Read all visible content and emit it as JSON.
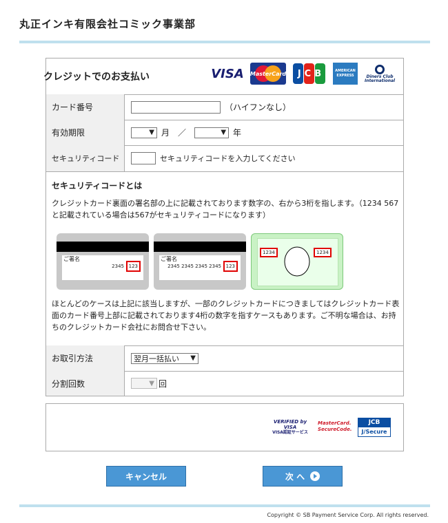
{
  "header": {
    "title": "丸正インキ有限会社コミック事業部"
  },
  "panel": {
    "title": "クレジットでのお支払い"
  },
  "brands": {
    "visa": "VISA",
    "mastercard": "MasterCard",
    "jcb": "JCB",
    "amex": "AMERICAN EXPRESS",
    "diners": "Diners Club International"
  },
  "form": {
    "card_number": {
      "label": "カード番号",
      "value": "",
      "note": "（ハイフンなし）"
    },
    "expiry": {
      "label": "有効期限",
      "month_suffix": "月",
      "separator": "／",
      "year_suffix": "年"
    },
    "security_code": {
      "label": "セキュリティコード",
      "value": "",
      "note": "セキュリティコードを入力してください"
    },
    "payment_method": {
      "label": "お取引方法",
      "selected": "翌月一括払い"
    },
    "installments": {
      "label": "分割回数",
      "suffix": "回"
    }
  },
  "info": {
    "title": "セキュリティコードとは",
    "p1": "クレジットカード裏面の署名部の上に記載されております数字の、右から3桁を指します。（1234 567と記載されている場合は567がセキュリティコードになります）",
    "p2": "ほとんどのケースは上記に該当しますが、一部のクレジットカードにつきましてはクレジットカード表面のカード番号上部に記載されております4桁の数字を指すケースもあります。ご不明な場合は、お持ちのクレジットカード会社にお問合せ下さい。",
    "card1": {
      "sign": "ご署名",
      "digits": "2345",
      "code": "123"
    },
    "card2": {
      "sign": "ご署名",
      "digits": "2345 2345 2345 2345",
      "code": "123"
    },
    "card3": {
      "left": "1234",
      "right": "1234"
    }
  },
  "secure_logos": {
    "visa_verified": "VERIFIED by VISA",
    "visa_sub": "VISA認証サービス",
    "mc_secure": "MasterCard. SecureCode.",
    "jsecure_top": "JCB",
    "jsecure_bottom": "J/Secure"
  },
  "buttons": {
    "cancel": "キャンセル",
    "next": "次 へ"
  },
  "footer": {
    "copyright": "Copyright © SB Payment Service Corp. All rights reserved."
  },
  "colors": {
    "accent": "#4a97d5",
    "rule": "#bfe0ee",
    "highlight": "#e00000"
  }
}
